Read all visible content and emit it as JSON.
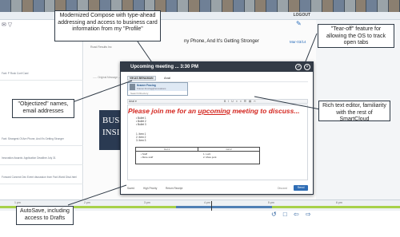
{
  "app": {
    "logout_label": "LOGOUT",
    "edit_icon": "pencil-icon",
    "folder_icons": "✉ ▽",
    "left_list": [
      "Fwd: P Rock Conf Card",
      "Fwd: Strongest Of Are Phone, And It's Getting Stronger",
      "Innovation Awards: Application Deadline July 31",
      "Forward Connect Dec Event discussion from Fwd World Discl.html"
    ]
  },
  "message": {
    "subject": "ny Phone, And It's Getting Stronger",
    "date": "Mar-03/14",
    "sender": "Road Results Inc",
    "original_header": "----- Original Message -----",
    "banner_text": "BUSI INSI"
  },
  "compose": {
    "title": "Upcoming meeting ... 3:30 PM",
    "tearoff_button": "↗",
    "close_button": "×",
    "to_chip": "VIKAS BENAMAN",
    "to_typed": "Anal",
    "typeahead": {
      "name": "Kramer Frocing",
      "email": "Kramer.Frocing@renovations",
      "directory_label": "Search Directory"
    },
    "toolbar_font": "Arial ▾",
    "toolbar_icons": "B I U ≡ ≡ ☰ ▤ ✂",
    "headline_before": "Please join me for an ",
    "headline_underlined": "upcoming",
    "headline_after": " meeting to discuss...",
    "bullets": [
      "Bullet 1",
      "Bullet 2",
      "Bullet 3"
    ],
    "numbered": [
      "Item 1",
      "Item 2",
      "Item 3"
    ],
    "table_headers": [
      "Col 1",
      "Col 2"
    ],
    "table_cell_1": [
      "Stuff",
      "More stuff"
    ],
    "table_cell_2": [
      "Lorit",
      "More junk"
    ],
    "status_saved": "Saved",
    "status_priority": "High Priority",
    "status_receipt": "Return Receipt",
    "discard_label": "Discard",
    "send_label": "Send"
  },
  "timeline": {
    "labels": [
      "1 pm",
      "2 pm",
      "3 pm",
      "4 pm",
      "5 pm",
      "6 pm"
    ],
    "bottom_icons": "↺ □ ⇦ ⇨"
  },
  "callouts": {
    "compose": "Modernized Compose with type-ahead addressing and access to business card information from my \"Profile\"",
    "tearoff": "\"Tear-off\" feature for allowing the OS to track open tabs",
    "objectized": "\"Objectized\" names, email addresses",
    "richtext": "Rich text editor, familiarity with the rest of SmartCloud",
    "autosave": "AutoSave, including access to Drafts"
  }
}
